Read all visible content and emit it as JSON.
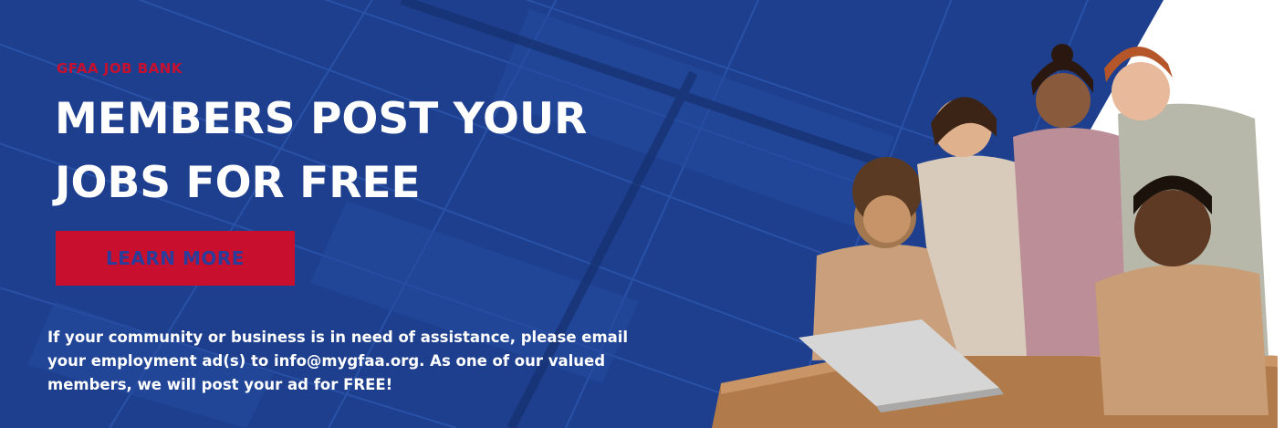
{
  "banner": {
    "eyebrow": "GFAA JOB BANK",
    "headline_line1": "MEMBERS POST YOUR",
    "headline_line2": "JOBS FOR FREE",
    "cta_label": "LEARN MORE",
    "body_line1": "If your community or business is in need of assistance, please email",
    "body_line2": "your employment ad(s) to info@mygfaa.org. As one of our valued",
    "body_line3": "members, we will post your ad for FREE!"
  },
  "colors": {
    "navy_background": "#1e3f8e",
    "accent_red": "#c8102e",
    "cta_text": "#2a3d9a",
    "text_white": "#ffffff"
  },
  "icons": {
    "background": "building-glass-grid-pattern",
    "photo": "team-gathered-around-laptop-photo"
  }
}
